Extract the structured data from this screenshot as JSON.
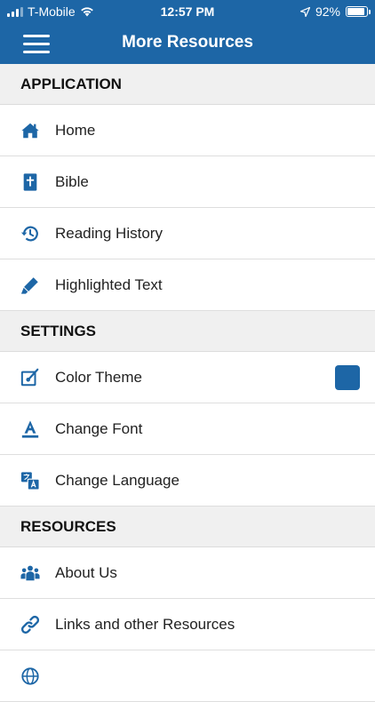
{
  "status": {
    "carrier": "T-Mobile",
    "time": "12:57 PM",
    "battery": "92%",
    "battery_level": 0.92
  },
  "header": {
    "title": "More Resources"
  },
  "sections": {
    "application": {
      "title": "APPLICATION",
      "items": [
        {
          "label": "Home",
          "icon": "home-icon"
        },
        {
          "label": "Bible",
          "icon": "bible-icon"
        },
        {
          "label": "Reading History",
          "icon": "history-icon"
        },
        {
          "label": "Highlighted Text",
          "icon": "highlighter-icon"
        }
      ]
    },
    "settings": {
      "title": "SETTINGS",
      "items": [
        {
          "label": "Color Theme",
          "icon": "color-theme-icon"
        },
        {
          "label": "Change Font",
          "icon": "font-icon"
        },
        {
          "label": "Change Language",
          "icon": "language-icon"
        }
      ]
    },
    "resources": {
      "title": "RESOURCES",
      "items": [
        {
          "label": "About Us",
          "icon": "people-icon"
        },
        {
          "label": "Links and other Resources",
          "icon": "link-icon"
        }
      ]
    }
  },
  "colors": {
    "brand": "#1d66a6",
    "theme_swatch": "#1d66a6",
    "section_bg": "#f0f0f0"
  }
}
